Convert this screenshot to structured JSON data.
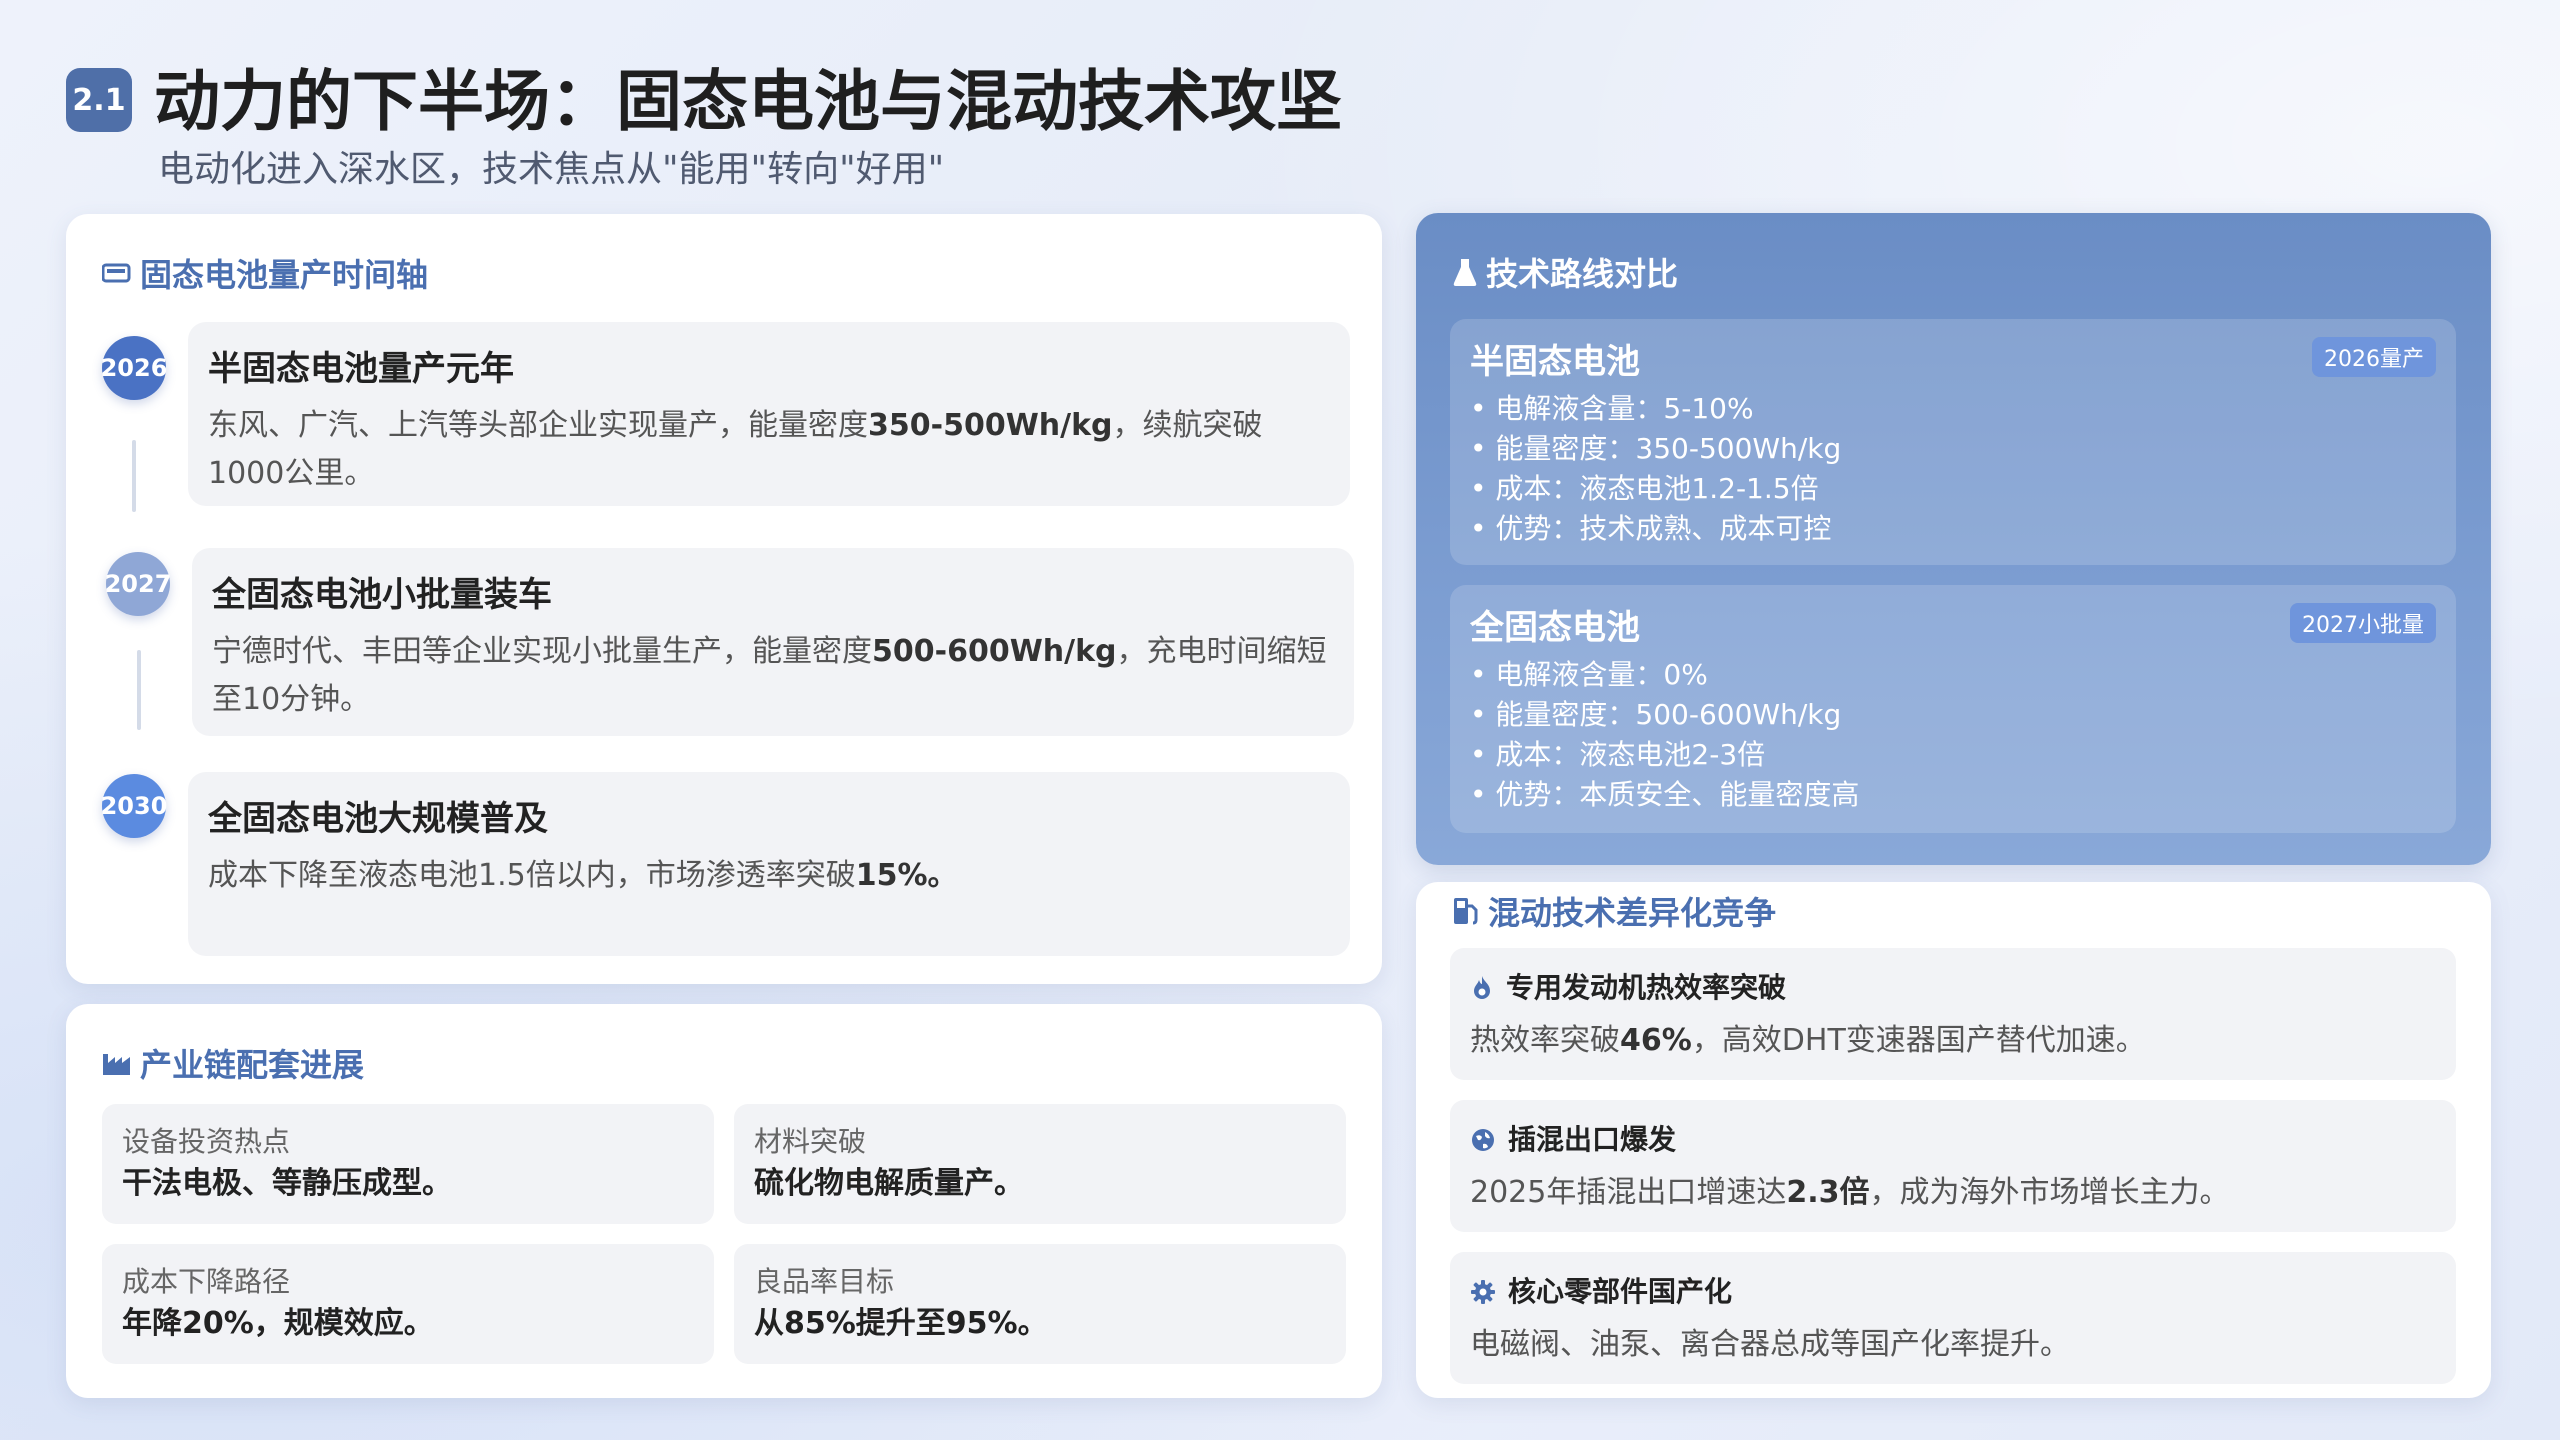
{
  "header": {
    "badge": "2.1",
    "title": "动力的下半场：固态电池与混动技术攻坚",
    "subtitle": "电动化进入深水区，技术焦点从\"能用\"转向\"好用\""
  },
  "timeline": {
    "title": "固态电池量产时间轴",
    "items": [
      {
        "year": "2026",
        "heading": "半固态电池量产元年",
        "text_a": "东风、广汽、上汽等头部企业实现量产，能量密度",
        "text_bold": "350-500Wh/kg",
        "text_b": "，续航突破1000公里。"
      },
      {
        "year": "2027",
        "heading": "全固态电池小批量装车",
        "text_a": "宁德时代、丰田等企业实现小批量生产，能量密度",
        "text_bold": "500-600Wh/kg",
        "text_b": "，充电时间缩短至10分钟。"
      },
      {
        "year": "2030",
        "heading": "全固态电池大规模普及",
        "text_a": "成本下降至液态电池1.5倍以内，市场渗透率突破",
        "text_bold": "15%。",
        "text_b": ""
      }
    ]
  },
  "industry": {
    "title": "产业链配套进展",
    "items": [
      {
        "label": "设备投资热点",
        "value": "干法电极、等静压成型。"
      },
      {
        "label": "材料突破",
        "value": "硫化物电解质量产。"
      },
      {
        "label": "成本下降路径",
        "value": "年降20%，规模效应。"
      },
      {
        "label": "良品率目标",
        "value": "从85%提升至95%。"
      }
    ]
  },
  "tech": {
    "title": "技术路线对比",
    "routes": [
      {
        "name": "半固态电池",
        "tag": "2026量产",
        "points": [
          "电解液含量：5-10%",
          "能量密度：350-500Wh/kg",
          "成本：液态电池1.2-1.5倍",
          "优势：技术成熟、成本可控"
        ]
      },
      {
        "name": "全固态电池",
        "tag": "2027小批量",
        "points": [
          "电解液含量：0%",
          "能量密度：500-600Wh/kg",
          "成本：液态电池2-3倍",
          "优势：本质安全、能量密度高"
        ]
      }
    ]
  },
  "hybrid": {
    "title": "混动技术差异化竞争",
    "items": [
      {
        "icon": "flame-icon",
        "heading": "专用发动机热效率突破",
        "text_a": "热效率突破",
        "text_bold": "46%",
        "text_b": "，高效DHT变速器国产替代加速。"
      },
      {
        "icon": "globe-icon",
        "heading": "插混出口爆发",
        "text_a": "2025年插混出口增速达",
        "text_bold": "2.3倍",
        "text_b": "，成为海外市场增长主力。"
      },
      {
        "icon": "gear-icon",
        "heading": "核心零部件国产化",
        "text_a": "电磁阀、油泵、离合器总成等国产化率提升。",
        "text_bold": "",
        "text_b": ""
      }
    ]
  },
  "colors": {
    "accent": "#4a6fb0",
    "dot_2026": "#4a72c4",
    "dot_2027": "#8fa7d6",
    "dot_2030": "#5b8be0"
  }
}
